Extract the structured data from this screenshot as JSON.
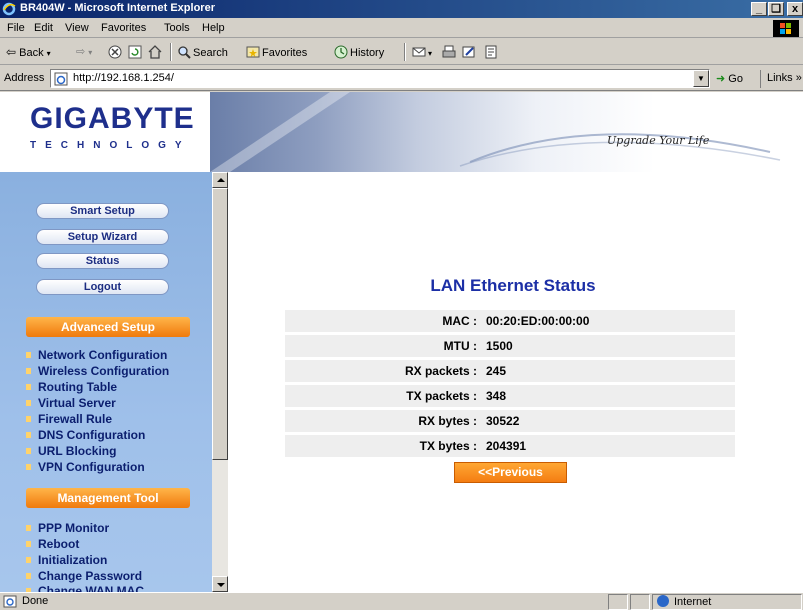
{
  "window": {
    "title": "BR404W - Microsoft Internet Explorer",
    "minimize": "_",
    "maximize": "❑",
    "close": "x"
  },
  "menu": [
    "File",
    "Edit",
    "View",
    "Favorites",
    "Tools",
    "Help"
  ],
  "toolbar": {
    "back": "Back",
    "search": "Search",
    "favorites": "Favorites",
    "history": "History"
  },
  "address": {
    "label": "Address",
    "url": "http://192.168.1.254/",
    "go": "Go",
    "links": "Links"
  },
  "banner": {
    "logo": "GIGABYTE",
    "logo_sub": "TECHNOLOGY",
    "slogan": "Upgrade Your Life"
  },
  "sidebar": {
    "buttons": [
      "Smart Setup",
      "Setup Wizard",
      "Status",
      "Logout"
    ],
    "advanced_title": "Advanced Setup",
    "advanced_links": [
      "Network Configuration",
      "Wireless Configuration",
      "Routing Table",
      "Virtual Server",
      "Firewall Rule",
      "DNS Configuration",
      "URL Blocking",
      "VPN Configuration"
    ],
    "management_title": "Management Tool",
    "management_links": [
      "PPP Monitor",
      "Reboot",
      "Initialization",
      "Change Password",
      "Change WAN MAC"
    ]
  },
  "status": {
    "title": "LAN Ethernet Status",
    "rows": [
      {
        "key": "MAC :",
        "value": "00:20:ED:00:00:00"
      },
      {
        "key": "MTU :",
        "value": "1500"
      },
      {
        "key": "RX packets :",
        "value": "245"
      },
      {
        "key": "TX packets :",
        "value": "348"
      },
      {
        "key": "RX bytes :",
        "value": "30522"
      },
      {
        "key": "TX bytes :",
        "value": "204391"
      }
    ],
    "previous": "<<Previous"
  },
  "statusbar": {
    "text": "Done",
    "zone": "Internet"
  },
  "colors": {
    "brand_blue": "#1c2fa6",
    "orange": "#f47d12",
    "sidebar_blue": "#9fc0ea"
  }
}
